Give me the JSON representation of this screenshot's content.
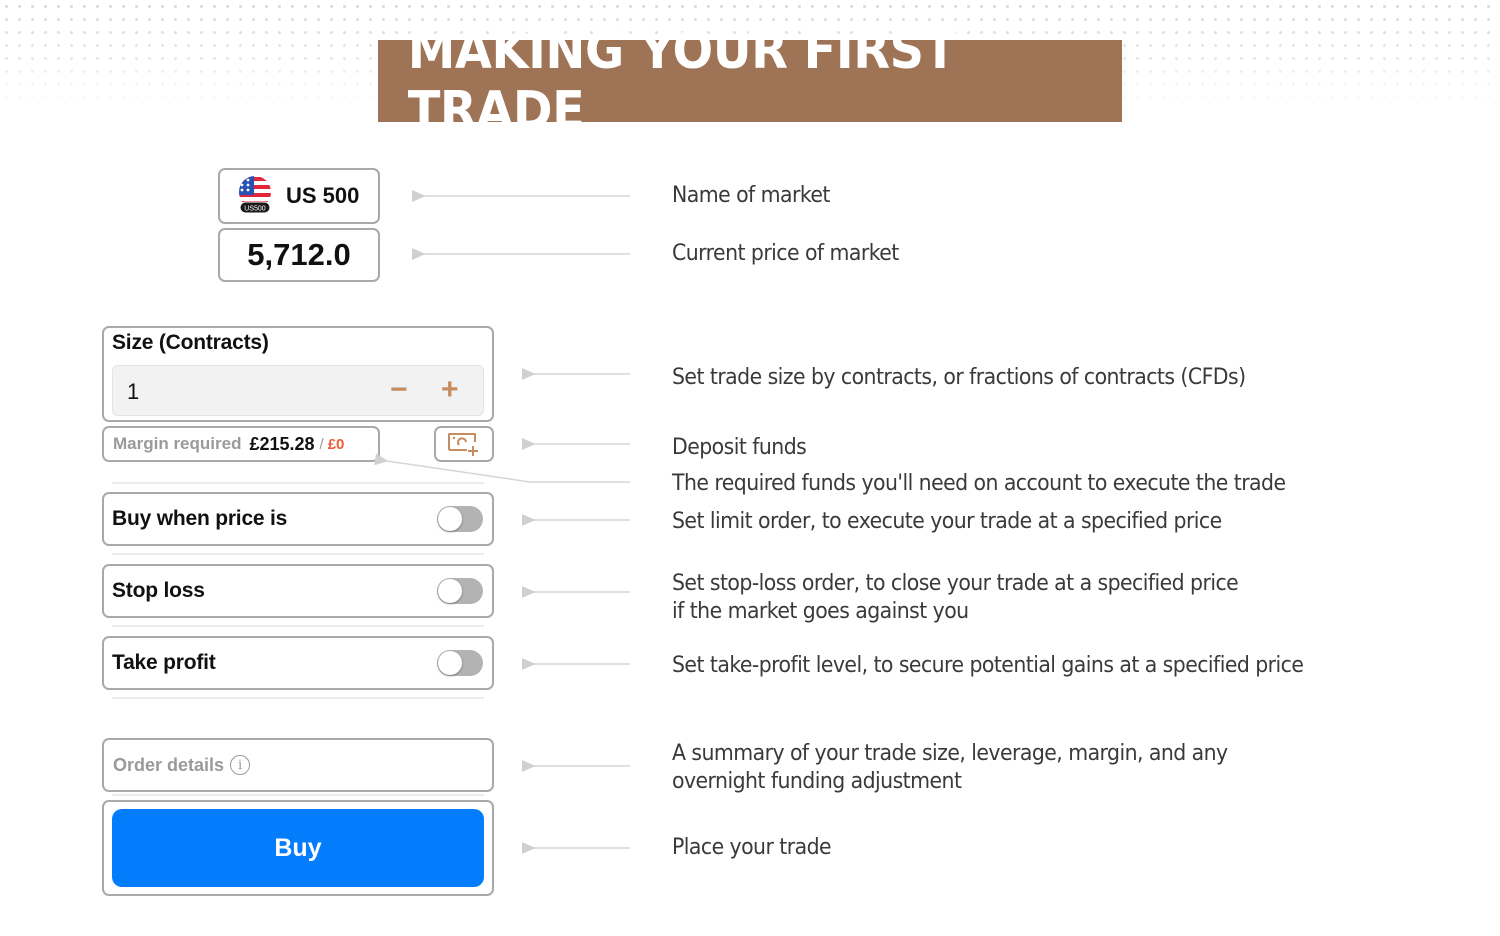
{
  "title": "MAKING YOUR FIRST TRADE",
  "colors": {
    "banner": "#9e7356",
    "buy_button": "#037dfb",
    "accent_icon": "#c68c62",
    "available_funds": "#f05a3a"
  },
  "market": {
    "flag_icon": "us-flag-icon",
    "badge": "US500",
    "name": "US 500",
    "price": "5,712.0"
  },
  "size": {
    "label": "Size (Contracts)",
    "value": "1",
    "decrement": "−",
    "increment": "+"
  },
  "margin": {
    "label": "Margin required",
    "value": "£215.28",
    "separator": "/",
    "available": "£0"
  },
  "deposit": {
    "icon": "deposit-funds-icon"
  },
  "toggles": [
    {
      "label": "Buy when price is",
      "on": false
    },
    {
      "label": "Stop loss",
      "on": false
    },
    {
      "label": "Take profit",
      "on": false
    }
  ],
  "order_details": {
    "label": "Order details",
    "icon": "info-icon",
    "icon_glyph": "i"
  },
  "buy_button": {
    "label": "Buy"
  },
  "descriptions": {
    "market_name": "Name of market",
    "market_price": "Current price of market",
    "size": "Set trade size by contracts, or fractions of contracts (CFDs)",
    "deposit": "Deposit funds",
    "margin": "The required funds you'll need on account to execute the trade",
    "limit": "Set limit order, to execute your trade at a specified price",
    "stop_loss_1": "Set stop-loss order, to close your trade at a specified price",
    "stop_loss_2": "if the market goes against you",
    "take_profit": "Set take-profit level, to secure potential gains at a specified price",
    "order_details_1": "A summary of your trade size, leverage, margin, and any",
    "order_details_2": "overnight funding adjustment",
    "buy": "Place your trade"
  }
}
